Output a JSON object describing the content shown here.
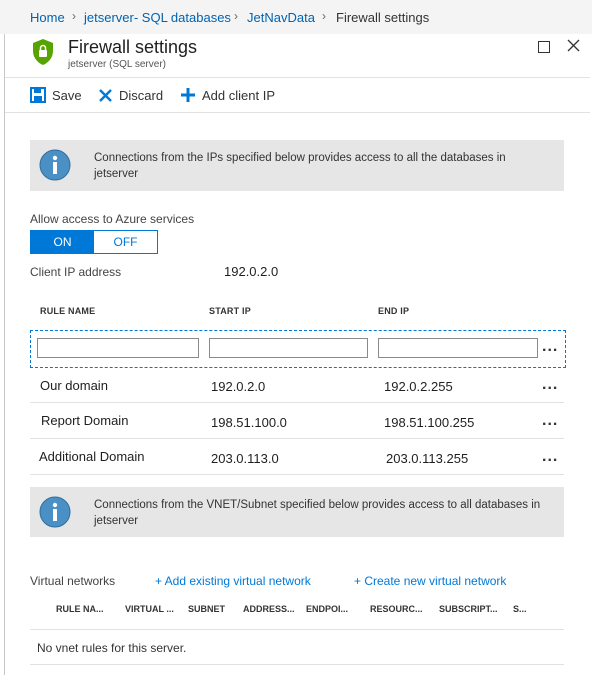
{
  "breadcrumb": {
    "items": [
      "Home",
      "jetserver- SQL databases",
      "JetNavData"
    ],
    "current": "Firewall settings"
  },
  "header": {
    "title": "Firewall settings",
    "subtitle": "jetserver (SQL server)"
  },
  "toolbar": {
    "save_label": "Save",
    "discard_label": "Discard",
    "add_client_ip_label": "Add client IP"
  },
  "info_banner_1": {
    "text": "Connections from the IPs specified below provides access to all the databases in jetserver"
  },
  "azure_services": {
    "label": "Allow access to Azure services",
    "on_label": "ON",
    "off_label": "OFF",
    "selected": "ON"
  },
  "client_ip": {
    "label": "Client IP address",
    "value": "192.0.2.0"
  },
  "rules_table": {
    "columns": [
      "RULE NAME",
      "START IP",
      "END IP"
    ],
    "new_row": {
      "rule_name": "",
      "start_ip": "",
      "end_ip": ""
    },
    "rows": [
      {
        "rule_name": "Our domain",
        "start_ip": "192.0.2.0",
        "end_ip": "192.0.2.255"
      },
      {
        "rule_name": "Report Domain",
        "start_ip": "198.51.100.0",
        "end_ip": "198.51.100.255"
      },
      {
        "rule_name": "Additional Domain",
        "start_ip": "203.0.113.0",
        "end_ip": "203.0.113.255"
      }
    ],
    "more_label": "..."
  },
  "info_banner_2": {
    "text": "Connections from the VNET/Subnet specified below provides access to all databases in jetserver"
  },
  "virtual_networks": {
    "label": "Virtual networks",
    "add_existing_label": "+ Add existing virtual network",
    "create_new_label": "+ Create new virtual network",
    "columns": [
      "RULE NA...",
      "VIRTUAL ...",
      "SUBNET",
      "ADDRESS...",
      "ENDPOI...",
      "RESOURC...",
      "SUBSCRIPT...",
      "S..."
    ],
    "empty_text": "No vnet rules for this server."
  },
  "colors": {
    "accent": "#0078d7",
    "shield": "#57a300",
    "info_icon": "#4a90c4",
    "banner_bg": "#e6e6e6"
  }
}
